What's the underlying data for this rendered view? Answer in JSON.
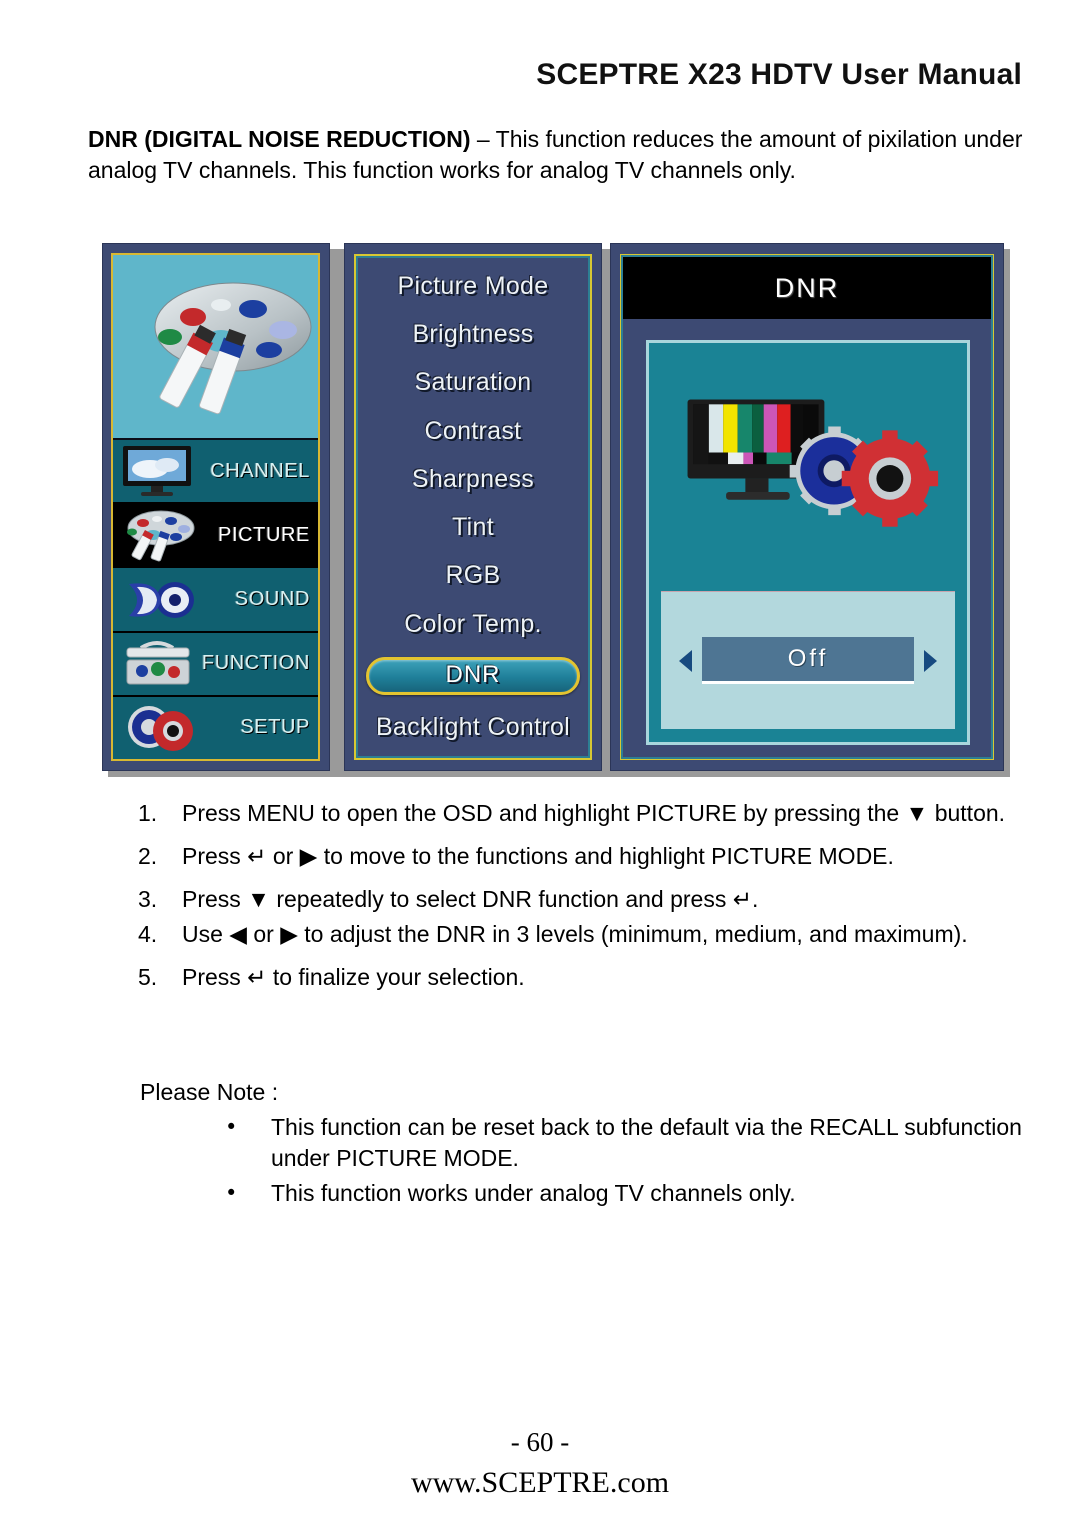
{
  "header": {
    "title": "SCEPTRE X23 HDTV User Manual"
  },
  "intro": {
    "lead": "DNR (DIGITAL NOISE REDUCTION)",
    "body": " – This function reduces the amount of pixilation under analog TV channels.  This function works for analog TV channels only."
  },
  "osd": {
    "categories": [
      {
        "label": "",
        "icon": "palette-icon",
        "selected": false,
        "hero": true
      },
      {
        "label": "CHANNEL",
        "icon": "tv-screen-icon",
        "selected": false
      },
      {
        "label": "PICTURE",
        "icon": "palette-icon",
        "selected": true
      },
      {
        "label": "SOUND",
        "icon": "speaker-icon",
        "selected": false
      },
      {
        "label": "FUNCTION",
        "icon": "toolbox-icon",
        "selected": false
      },
      {
        "label": "SETUP",
        "icon": "gears-icon",
        "selected": false
      }
    ],
    "functions": [
      {
        "label": "Picture Mode",
        "highlight": false
      },
      {
        "label": "Brightness",
        "highlight": false
      },
      {
        "label": "Saturation",
        "highlight": false
      },
      {
        "label": "Contrast",
        "highlight": false
      },
      {
        "label": "Sharpness",
        "highlight": false
      },
      {
        "label": "Tint",
        "highlight": false
      },
      {
        "label": "RGB",
        "highlight": false
      },
      {
        "label": "Color Temp.",
        "highlight": false
      },
      {
        "label": "DNR",
        "highlight": true
      },
      {
        "label": "Backlight Control",
        "highlight": false
      }
    ],
    "value_panel": {
      "title": "DNR",
      "value": "Off",
      "left_arrow": "left-arrow-icon",
      "right_arrow": "right-arrow-icon"
    },
    "colors": {
      "panel_bg": "#3d4a73",
      "gold_border": "#d8c832",
      "teal_border": "#2d7f93",
      "hero_bg": "#5fb6ca",
      "item_bg": "#106070",
      "selected_bg": "#000000",
      "stage_bg": "#1a8395",
      "tray_bg": "#b3d8dd",
      "value_box_bg": "#4e7593"
    }
  },
  "steps": [
    {
      "num": "1.",
      "text": "Press MENU to open the OSD and highlight PICTURE by pressing the ▼ button."
    },
    {
      "num": "2.",
      "text": "Press ↵ or ▶ to move to the functions and highlight PICTURE MODE."
    },
    {
      "num": "3.",
      "text": "Press ▼ repeatedly to select DNR function and press ↵."
    },
    {
      "num": "4.",
      "text": "Use ◀ or ▶ to adjust the DNR in 3 levels (minimum, medium, and maximum)."
    },
    {
      "num": "5.",
      "text": "Press ↵ to finalize your selection."
    }
  ],
  "note": {
    "heading": "Please Note :",
    "bullet_glyph": "•",
    "items": [
      "This function can be reset back to the default via the RECALL subfunction under PICTURE MODE.",
      "This function works under analog TV channels only."
    ]
  },
  "footer": {
    "page": "- 60 -",
    "url": "www.SCEPTRE.com"
  }
}
